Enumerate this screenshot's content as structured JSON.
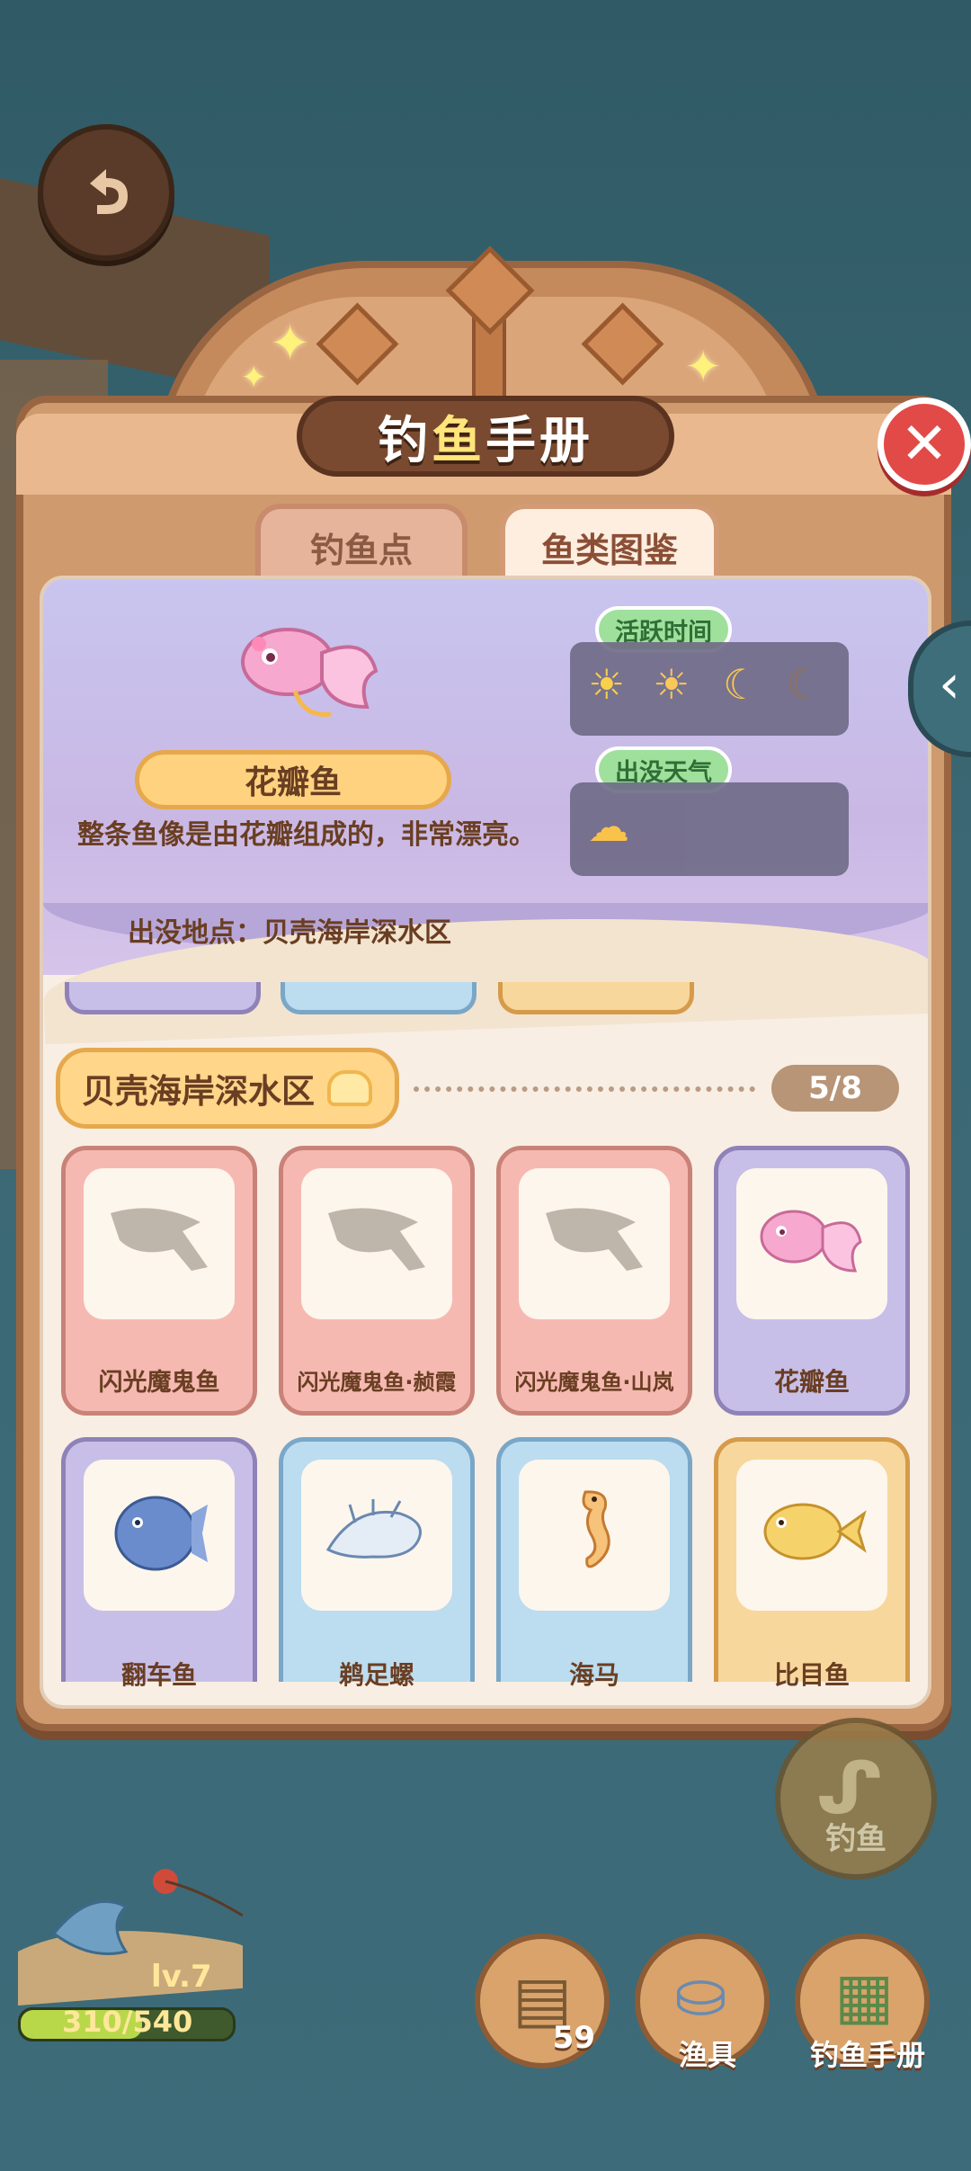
{
  "header": {
    "title_left": "钓",
    "title_accent": "鱼",
    "title_right": "手册"
  },
  "tabs": [
    {
      "label": "钓鱼点"
    },
    {
      "label": "鱼类图鉴"
    }
  ],
  "selected_fish": {
    "name": "花瓣鱼",
    "description": "整条鱼像是由花瓣组成的，非常漂亮。",
    "location": "出没地点：贝壳海岸深水区",
    "active_time_label": "活跃时间",
    "weather_label": "出没天气",
    "active_time_icons": [
      "sun-icon",
      "sunset-icon",
      "moon-icon",
      "night-cloud-icon"
    ],
    "weather_icons": [
      "rain-cloud-icon"
    ]
  },
  "region": {
    "name": "贝壳海岸深水区",
    "progress": "5/8"
  },
  "fish_cards": [
    {
      "name": "闪光魔鬼鱼",
      "color": "pink",
      "discovered": false
    },
    {
      "name": "闪光魔鬼鱼·赪霞",
      "color": "pink",
      "discovered": false
    },
    {
      "name": "闪光魔鬼鱼·山岚",
      "color": "pink",
      "discovered": false
    },
    {
      "name": "花瓣鱼",
      "color": "purple",
      "discovered": true
    },
    {
      "name": "翻车鱼",
      "color": "purple",
      "discovered": true
    },
    {
      "name": "鹈足螺",
      "color": "blue",
      "discovered": true
    },
    {
      "name": "海马",
      "color": "blue",
      "discovered": true
    },
    {
      "name": "比目鱼",
      "color": "gold",
      "discovered": true
    }
  ],
  "hud": {
    "level": "lv.7",
    "exp": "310/540",
    "exp_fraction": 0.574,
    "fish_button_label": "钓鱼",
    "bait_count": "59",
    "gear_label": "渔具",
    "handbook_label": "钓鱼手册"
  },
  "colors": {
    "accent": "#ffe57a",
    "close": "#e24a48",
    "pill_green": "#9fe09c"
  }
}
